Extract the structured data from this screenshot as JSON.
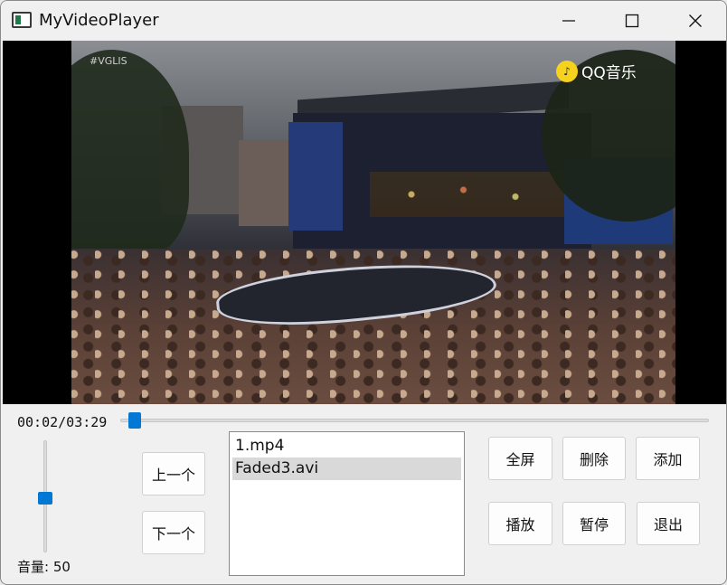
{
  "window": {
    "title": "MyVideoPlayer"
  },
  "video": {
    "watermark_left": "#VGLIS",
    "logo_text": "QQ音乐"
  },
  "player": {
    "time": "00:02/03:29",
    "progress": 0.01,
    "volume_label": "音量: 50",
    "volume": 50
  },
  "buttons": {
    "prev": "上一个",
    "next": "下一个",
    "fullscreen": "全屏",
    "delete": "删除",
    "add": "添加",
    "play": "播放",
    "pause": "暂停",
    "exit": "退出"
  },
  "playlist": {
    "items": [
      {
        "label": "1.mp4",
        "selected": false
      },
      {
        "label": "Faded3.avi",
        "selected": true
      }
    ]
  },
  "colors": {
    "accent": "#0078d4",
    "selection": "#d9d9d9",
    "window_bg": "#f0f0f0"
  },
  "icons": {
    "app": "window-app-icon",
    "minimize": "minimize-icon",
    "maximize": "maximize-icon",
    "close": "close-icon"
  }
}
